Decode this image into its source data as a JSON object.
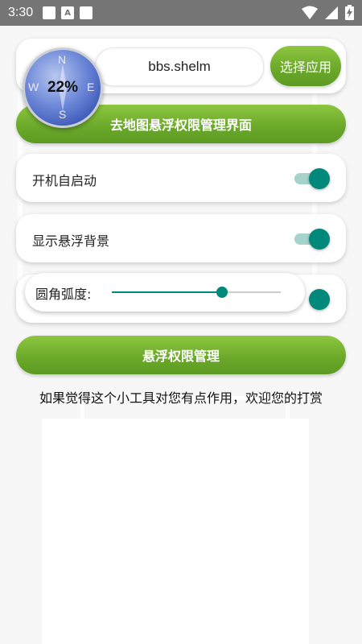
{
  "status_bar": {
    "time": "3:30",
    "left_icons": [
      "notification-square-icon",
      "a-notification-icon",
      "notification-square-icon"
    ],
    "right_icons": [
      "wifi-icon",
      "signal-icon",
      "battery-charging-icon"
    ]
  },
  "app_row": {
    "package_value": "bbs.shelm",
    "choose_button": "选择应用"
  },
  "floating_compass": {
    "percent": "22%",
    "letters": {
      "n": "N",
      "e": "E",
      "s": "S",
      "w": "W"
    }
  },
  "map_permission_button": "去地图悬浮权限管理界面",
  "settings": {
    "autostart": {
      "label": "开机自启动",
      "on": true
    },
    "show_background": {
      "label": "显示悬浮背景",
      "on": true
    }
  },
  "corner_radius": {
    "label": "圆角弧度:",
    "value_fraction": 0.65
  },
  "float_permission_button": "悬浮权限管理",
  "thanks_text": "如果觉得这个小工具对您有点作用，欢迎您的打赏",
  "colors": {
    "accent_green": "#6aa82a",
    "switch_teal": "#00897b",
    "status_bar": "#757575"
  }
}
